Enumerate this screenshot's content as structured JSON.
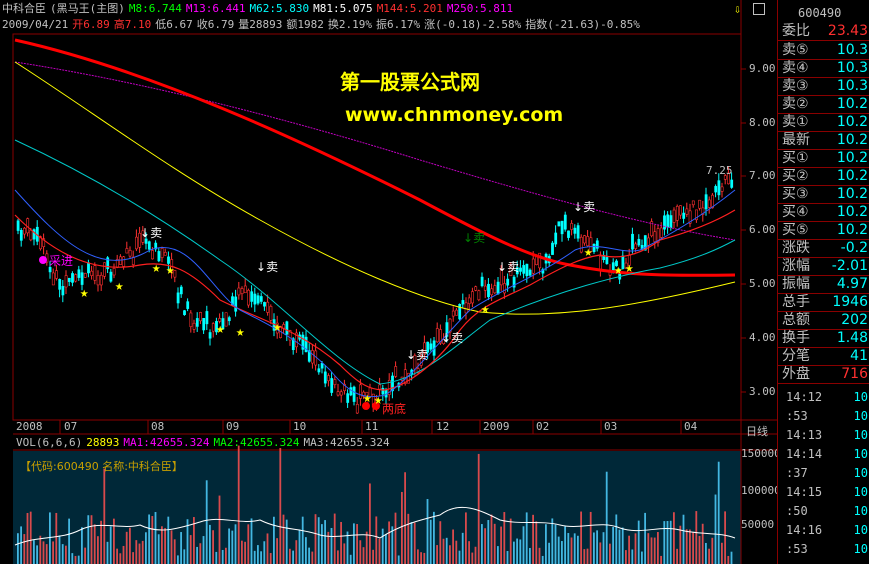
{
  "header": {
    "stock_name": "中科合臣",
    "indicator_name": "(黑马王(主图)",
    "ma_lines": [
      {
        "label": "M8:6.744",
        "color": "#00ff00"
      },
      {
        "label": "M13:6.441",
        "color": "#ff00ff"
      },
      {
        "label": "M62:5.830",
        "color": "#00ffff"
      },
      {
        "label": "M81:5.075",
        "color": "#ffffff"
      },
      {
        "label": "M144:5.201",
        "color": "#ff3030"
      },
      {
        "label": "M250:5.811",
        "color": "#ff00ff"
      }
    ],
    "date": "2009/04/21",
    "open": "开6.89",
    "high": "高7.10",
    "low": "低6.67",
    "close": "收6.79",
    "volume": "量28893",
    "amount": "额1982",
    "turnover": "换2.19%",
    "amplitude": "振6.17%",
    "change": "涨(-0.18)-2.58%",
    "index": "指数(-21.63)-0.85%"
  },
  "watermark": {
    "title": "第一股票公式网",
    "url": "www.chnmoney.com"
  },
  "price_axis": [
    "9.00",
    "8.00",
    "7.00",
    "6.00",
    "5.00",
    "4.00",
    "3.00"
  ],
  "date_axis": [
    "2008",
    "07",
    "08",
    "09",
    "10",
    "11",
    "12",
    "2009",
    "02",
    "03",
    "04"
  ],
  "price_annotation": "7.25",
  "signals": {
    "buy_in": "采进",
    "sell": "卖",
    "bottom": "两底"
  },
  "volume_panel": {
    "title": "VOL(6,6,6)",
    "vol": "28893",
    "ma1": "MA1:42655.324",
    "ma2": "MA2:42655.324",
    "ma3": "MA3:42655.324",
    "code_line": "【代码:600490 名称:中科合臣】",
    "axis": [
      "150000",
      "100000",
      "50000"
    ]
  },
  "right_panel": {
    "code": "600490",
    "weibi_label": "委比",
    "weibi_value": "23.43",
    "rows": [
      {
        "label": "卖⑤",
        "value": "10.3"
      },
      {
        "label": "卖④",
        "value": "10.3"
      },
      {
        "label": "卖③",
        "value": "10.3"
      },
      {
        "label": "卖②",
        "value": "10.2"
      },
      {
        "label": "卖①",
        "value": "10.2"
      },
      {
        "label": "最新",
        "value": "10.2"
      },
      {
        "label": "买①",
        "value": "10.2"
      },
      {
        "label": "买②",
        "value": "10.2"
      },
      {
        "label": "买③",
        "value": "10.2"
      },
      {
        "label": "买④",
        "value": "10.2"
      },
      {
        "label": "买⑤",
        "value": "10.2"
      },
      {
        "label": "涨跌",
        "value": "-0.2"
      },
      {
        "label": "涨幅",
        "value": "-2.01"
      },
      {
        "label": "振幅",
        "value": "4.97"
      },
      {
        "label": "总手",
        "value": "1946"
      },
      {
        "label": "总额",
        "value": "202"
      },
      {
        "label": "换手",
        "value": "1.48"
      },
      {
        "label": "分笔",
        "value": "41"
      },
      {
        "label": "外盘",
        "value": "716"
      }
    ],
    "ticks": [
      {
        "time": "14:12",
        "value": "10"
      },
      {
        "time": ":53",
        "value": "10"
      },
      {
        "time": "14:13",
        "value": "10"
      },
      {
        "time": "14:14",
        "value": "10"
      },
      {
        "time": ":37",
        "value": "10"
      },
      {
        "time": "14:15",
        "value": "10"
      },
      {
        "time": ":50",
        "value": "10"
      },
      {
        "time": "14:16",
        "value": "10"
      },
      {
        "time": ":53",
        "value": "10"
      }
    ],
    "period": "日线"
  },
  "colors": {
    "up": "#ff3030",
    "down": "#00ffff",
    "ma_red": "#ff0000",
    "ma_yellow": "#ffff00",
    "ma_cyan": "#00c8c8",
    "ma_magenta": "#c000c0",
    "panel_border": "#8a0000",
    "volume_bg": "#002838"
  }
}
